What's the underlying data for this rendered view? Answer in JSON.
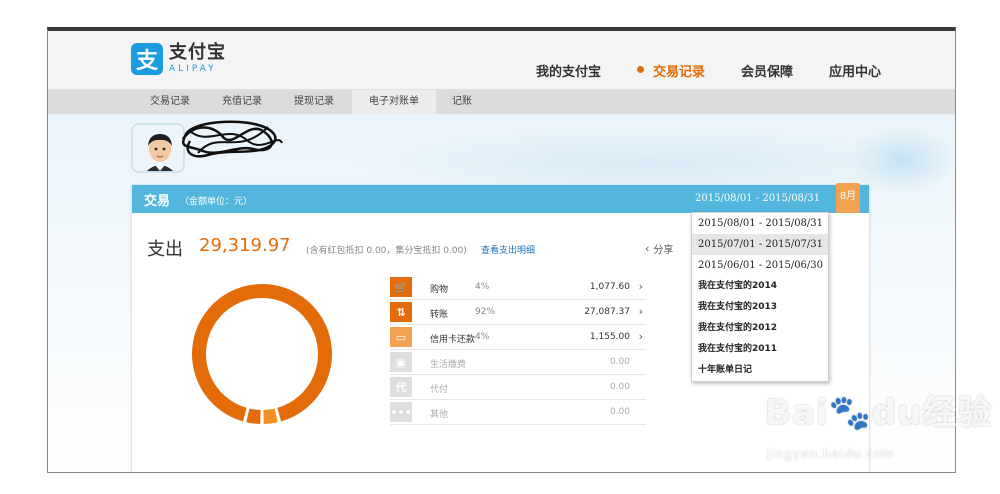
{
  "logo": {
    "mark": "支",
    "name_cn": "支付宝",
    "name_en": "ALIPAY"
  },
  "topnav": [
    {
      "label": "我的支付宝"
    },
    {
      "label": "交易记录",
      "active": true
    },
    {
      "label": "会员保障"
    },
    {
      "label": "应用中心"
    }
  ],
  "subnav": [
    {
      "label": "交易记录"
    },
    {
      "label": "充值记录"
    },
    {
      "label": "提现记录"
    },
    {
      "label": "电子对账单",
      "active": true
    },
    {
      "label": "记账"
    }
  ],
  "card": {
    "title": "交易",
    "unit": "（金额单位：元）",
    "date_range": "2015/08/01 - 2015/08/31",
    "month_tag": "8月"
  },
  "spend": {
    "label": "支出",
    "amount": "29,319.97",
    "note": "(含有红包抵扣 0.00，集分宝抵扣 0.00)",
    "link": "查看支出明细",
    "share": "分享"
  },
  "categories": [
    {
      "icon": "shopping-cart-icon",
      "glyph": "🛒",
      "name": "购物",
      "pct": "4%",
      "amount": "1,077.60",
      "color": "#e36c09",
      "arrow": "›"
    },
    {
      "icon": "transfer-icon",
      "glyph": "⇅",
      "name": "转账",
      "pct": "92%",
      "amount": "27,087.37",
      "color": "#e36c09",
      "arrow": "›"
    },
    {
      "icon": "credit-card-icon",
      "glyph": "▭",
      "name": "信用卡还款",
      "pct": "4%",
      "amount": "1,155.00",
      "color": "#f2a251",
      "arrow": "›"
    },
    {
      "icon": "utility-icon",
      "glyph": "▣",
      "name": "生活缴费",
      "pct": "",
      "amount": "0.00",
      "color": "#dedede",
      "arrow": ""
    },
    {
      "icon": "pay-for-others-icon",
      "glyph": "代",
      "name": "代付",
      "pct": "",
      "amount": "0.00",
      "color": "#dedede",
      "arrow": ""
    },
    {
      "icon": "more-icon",
      "glyph": "•••",
      "name": "其他",
      "pct": "",
      "amount": "0.00",
      "color": "#dedede",
      "arrow": ""
    }
  ],
  "chart_data": {
    "type": "pie",
    "categories": [
      "转账",
      "购物",
      "信用卡还款"
    ],
    "values": [
      92,
      4,
      4
    ],
    "colors": [
      "#e36c09",
      "#f0901e",
      "#e36c09"
    ]
  },
  "dropdown": [
    {
      "label": "2015/08/01 - 2015/08/31"
    },
    {
      "label": "2015/07/01 - 2015/07/31",
      "hover": true
    },
    {
      "label": "2015/06/01 - 2015/06/30"
    },
    {
      "label": "我在支付宝的2014",
      "bold": true
    },
    {
      "label": "我在支付宝的2013",
      "bold": true
    },
    {
      "label": "我在支付宝的2012",
      "bold": true
    },
    {
      "label": "我在支付宝的2011",
      "bold": true
    },
    {
      "label": "十年账单日记",
      "bold": true
    }
  ],
  "watermark": {
    "logo": "Bai🐾du经验",
    "url": "jingyan.baidu.com"
  }
}
